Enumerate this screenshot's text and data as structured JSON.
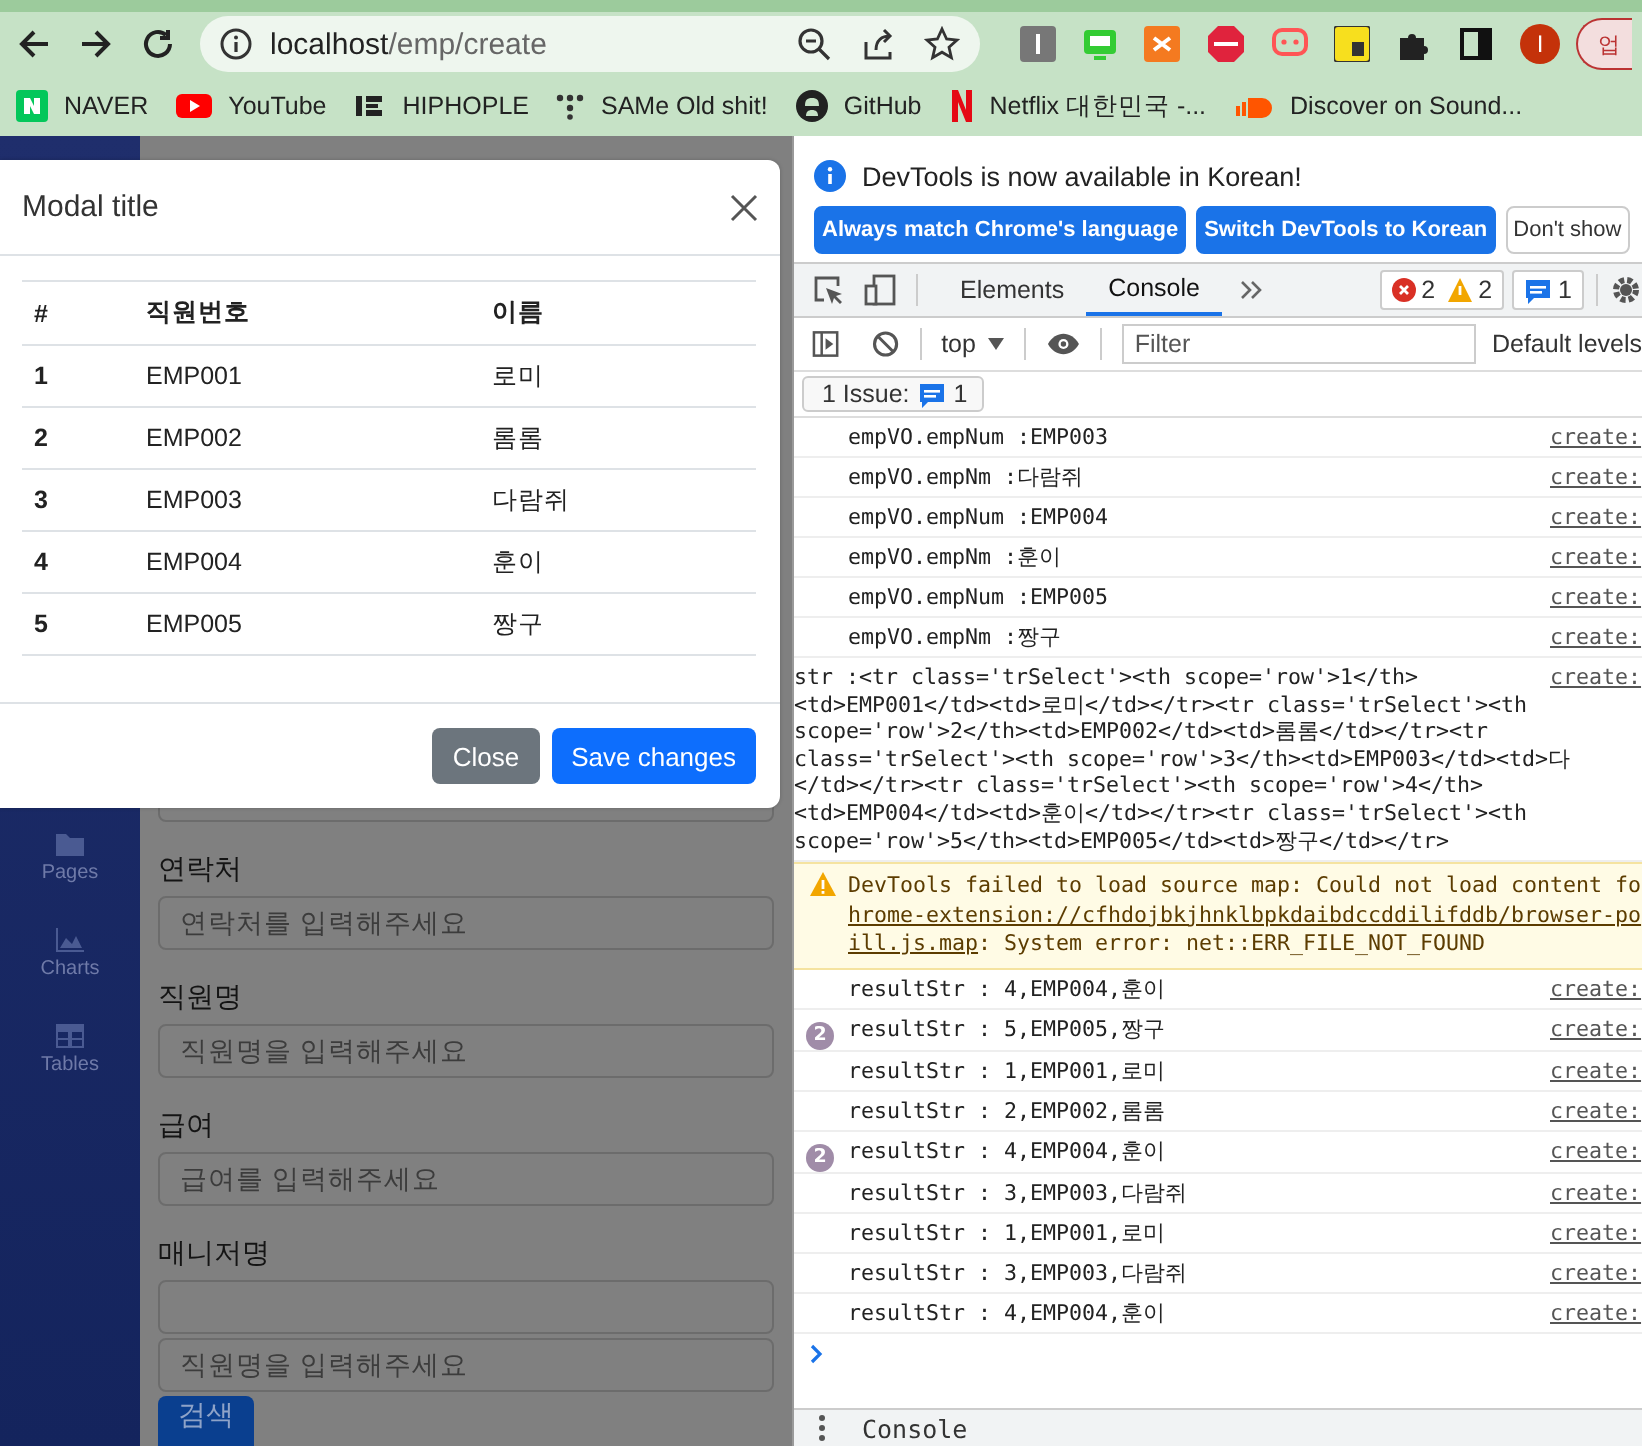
{
  "browser": {
    "address": {
      "host": "localhost",
      "path": "/emp/create"
    },
    "profile": "I",
    "update_button": "업"
  },
  "bookmarks": [
    {
      "label": "NAVER",
      "kind": "naver"
    },
    {
      "label": "YouTube",
      "kind": "youtube"
    },
    {
      "label": "HIPHOPLE",
      "kind": "hiphople"
    },
    {
      "label": "SAMe Old shit!",
      "kind": "dots"
    },
    {
      "label": "GitHub",
      "kind": "github"
    },
    {
      "label": "Netflix 대한민국 -...",
      "kind": "netflix"
    },
    {
      "label": "Discover on Sound...",
      "kind": "soundcloud"
    }
  ],
  "page": {
    "sidebar": {
      "items": [
        {
          "label": "Pages",
          "kind": "folder"
        },
        {
          "label": "Charts",
          "kind": "chart"
        },
        {
          "label": "Tables",
          "kind": "table"
        }
      ]
    },
    "form": {
      "covered_field": true,
      "groups": [
        {
          "label": "연락처",
          "inputs": [
            {
              "placeholder": "연락처를 입력해주세요"
            }
          ]
        },
        {
          "label": "직원명",
          "inputs": [
            {
              "placeholder": "직원명을 입력해주세요"
            }
          ]
        },
        {
          "label": "급여",
          "inputs": [
            {
              "placeholder": "급여를 입력해주세요"
            }
          ]
        },
        {
          "label": "매니저명",
          "blank_input": true,
          "inputs": [
            {
              "placeholder": "직원명을 입력해주세요"
            }
          ]
        }
      ],
      "button": "검색"
    }
  },
  "modal": {
    "title": "Modal title",
    "columns": [
      "#",
      "직원번호",
      "이름"
    ],
    "rows": [
      [
        "1",
        "EMP001",
        "로미"
      ],
      [
        "2",
        "EMP002",
        "롬롬"
      ],
      [
        "3",
        "EMP003",
        "다람쥐"
      ],
      [
        "4",
        "EMP004",
        "훈이"
      ],
      [
        "5",
        "EMP005",
        "짱구"
      ]
    ],
    "buttons": [
      {
        "label": "Close",
        "kind": "secondary"
      },
      {
        "label": "Save changes",
        "kind": "primary"
      }
    ]
  },
  "devtools": {
    "infobar": {
      "message": "DevTools is now available in Korean!",
      "buttons": [
        {
          "label": "Always match Chrome's language",
          "kind": "primary"
        },
        {
          "label": "Switch DevTools to Korean",
          "kind": "primary"
        },
        {
          "label": "Don't show",
          "kind": "plain"
        }
      ]
    },
    "tabs": [
      {
        "label": "Elements",
        "selected": false
      },
      {
        "label": "Console",
        "selected": true
      }
    ],
    "errors": "2",
    "warnings": "2",
    "messages": "1",
    "context": "top",
    "filter_placeholder": "Filter",
    "levels": "Default levels",
    "issues": {
      "label": "1 Issue:",
      "count": "1"
    },
    "logs": [
      {
        "kind": "log",
        "text": "empVO.empNum :EMP003",
        "source": "create:"
      },
      {
        "kind": "log",
        "text": "empVO.empNm :다람쥐",
        "source": "create:"
      },
      {
        "kind": "log",
        "text": "empVO.empNum :EMP004",
        "source": "create:"
      },
      {
        "kind": "log",
        "text": "empVO.empNm :훈이",
        "source": "create:"
      },
      {
        "kind": "log",
        "text": "empVO.empNum :EMP005",
        "source": "create:"
      },
      {
        "kind": "log",
        "text": "empVO.empNm :짱구",
        "source": "create:"
      },
      {
        "kind": "multiline",
        "source": "create:",
        "lines": [
          "str :<tr class='trSelect'><th scope='row'>1</th>",
          "<td>EMP001</td><td>로미</td></tr><tr class='trSelect'><th",
          "scope='row'>2</th><td>EMP002</td><td>롬롬</td></tr><tr",
          "class='trSelect'><th scope='row'>3</th><td>EMP003</td><td>다",
          "</td></tr><tr class='trSelect'><th scope='row'>4</th>",
          "<td>EMP004</td><td>훈이</td></tr><tr class='trSelect'><th",
          "scope='row'>5</th><td>EMP005</td><td>짱구</td></tr>"
        ]
      },
      {
        "kind": "warning",
        "text": "DevTools failed to load source map: Could not load content fo",
        "link": "hrome-extension://cfhdojbkjhnklbpkdaibdccddilifddb/browser-po",
        "link_end": "ill.js.map",
        "tail": ": System error: net::ERR_FILE_NOT_FOUND"
      },
      {
        "kind": "log",
        "text": "resultStr : 4,EMP004,훈이",
        "source": "create:"
      },
      {
        "kind": "log",
        "text": "resultStr : 5,EMP005,짱구",
        "repeat": "2",
        "source": "create:"
      },
      {
        "kind": "log",
        "text": "resultStr : 1,EMP001,로미",
        "source": "create:"
      },
      {
        "kind": "log",
        "text": "resultStr : 2,EMP002,롬롬",
        "source": "create:"
      },
      {
        "kind": "log",
        "text": "resultStr : 4,EMP004,훈이",
        "repeat": "2",
        "source": "create:"
      },
      {
        "kind": "log",
        "text": "resultStr : 3,EMP003,다람쥐",
        "source": "create:"
      },
      {
        "kind": "log",
        "text": "resultStr : 1,EMP001,로미",
        "source": "create:"
      },
      {
        "kind": "log",
        "text": "resultStr : 3,EMP003,다람쥐",
        "source": "create:"
      },
      {
        "kind": "log",
        "text": "resultStr : 4,EMP004,훈이",
        "source": "create:"
      }
    ],
    "drawer": {
      "tab": "Console"
    }
  }
}
